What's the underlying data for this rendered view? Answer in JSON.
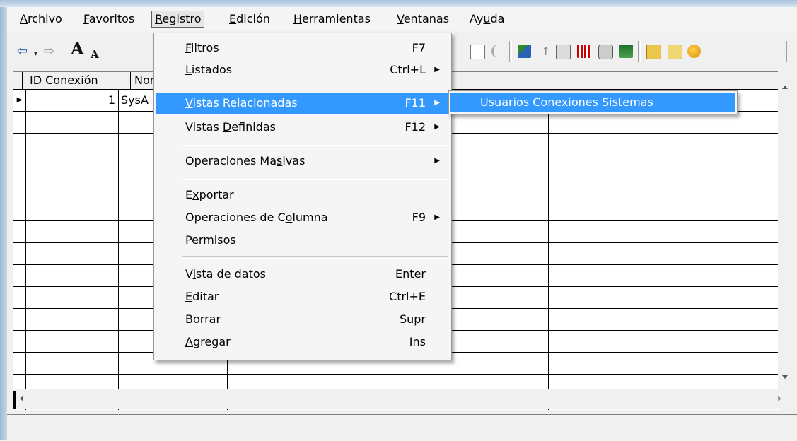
{
  "menubar": {
    "items": [
      {
        "label": "Archivo",
        "key": "A",
        "rest": "rchivo"
      },
      {
        "label": "Favoritos",
        "key": "F",
        "rest": "avoritos"
      },
      {
        "label": "Registro",
        "key": "R",
        "rest": "egistro"
      },
      {
        "label": "Edición",
        "key": "E",
        "rest": "dición"
      },
      {
        "label": "Herramientas",
        "key": "H",
        "rest": "erramientas"
      },
      {
        "label": "Ventanas",
        "key": "V",
        "rest": "entanas"
      },
      {
        "label": "Ayuda",
        "pre": "Ay",
        "key": "u",
        "rest": "da"
      }
    ]
  },
  "toolbar": {
    "back_glyph": "⇦",
    "dropdown_glyph": "▾",
    "forward_glyph": "⇨",
    "font_increase_glyph": "A",
    "font_decrease_glyph": "A",
    "up_glyph": "↑",
    "accent_color": "#2a62b3"
  },
  "grid": {
    "columns": [
      "ID Conexión",
      "Nom"
    ],
    "rows": [
      {
        "id": "1",
        "name": "SysA"
      }
    ],
    "row_indicator_glyph": "▶"
  },
  "registro_menu": {
    "groups": [
      [
        {
          "pre": "",
          "key": "F",
          "rest": "iltros",
          "shortcut": "F7",
          "submenu": false
        },
        {
          "pre": "",
          "key": "L",
          "rest": "istados",
          "shortcut": "Ctrl+L",
          "submenu": true
        }
      ],
      [
        {
          "pre": "",
          "key": "V",
          "rest": "istas Relacionadas",
          "shortcut": "F11",
          "submenu": true,
          "highlighted": true
        },
        {
          "pre": "Vistas ",
          "key": "D",
          "rest": "efinidas",
          "shortcut": "F12",
          "submenu": true
        }
      ],
      [
        {
          "pre": "Operaciones Ma",
          "key": "s",
          "rest": "ivas",
          "shortcut": "",
          "submenu": true
        }
      ],
      [
        {
          "pre": "E",
          "key": "x",
          "rest": "portar",
          "shortcut": "",
          "submenu": false
        },
        {
          "pre": "Operaciones de C",
          "key": "o",
          "rest": "lumna",
          "shortcut": "F9",
          "submenu": true
        },
        {
          "pre": "",
          "key": "P",
          "rest": "ermisos",
          "shortcut": "",
          "submenu": false
        }
      ],
      [
        {
          "pre": "V",
          "key": "i",
          "rest": "sta de datos",
          "shortcut": "Enter",
          "submenu": false
        },
        {
          "pre": "",
          "key": "E",
          "rest": "ditar",
          "shortcut": "Ctrl+E",
          "submenu": false
        },
        {
          "pre": "",
          "key": "B",
          "rest": "orrar",
          "shortcut": "Supr",
          "submenu": false
        },
        {
          "pre": "",
          "key": "A",
          "rest": "gregar",
          "shortcut": "Ins",
          "submenu": false
        }
      ]
    ]
  },
  "submenu": {
    "item": {
      "key": "U",
      "rest": "suarios Conexiones Sistemas"
    }
  },
  "colors": {
    "highlight": "#3399ff",
    "menu_bg": "#f5f5f5",
    "window_frame": "#a9c2dc"
  }
}
